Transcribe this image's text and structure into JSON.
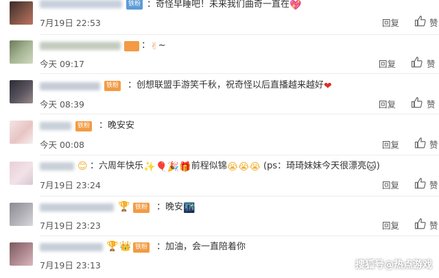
{
  "colors": {
    "badge_blue": "#5b9bd5",
    "badge_orange": "#f29b44",
    "heart": "#e02a2a"
  },
  "comments": [
    {
      "badge": "铁粉",
      "text": "奇怪早睡吧！未来我们曲奇一直在",
      "emoji_end": "sparkle-heart",
      "time": "7月19日 22:53",
      "reply": "回复",
      "likes": "赞"
    },
    {
      "badge": "",
      "text": "",
      "emoji_end": "victory-hand",
      "suffix": "~",
      "time": "今天 09:17",
      "reply": "回复",
      "likes": "赞"
    },
    {
      "badge": "铁粉",
      "text": "创想联盟手游笑千秋，祝奇怪以后直播越来越好",
      "emoji_end": "red-heart",
      "time": "今天 08:39",
      "reply": "回复",
      "likes": "赞"
    },
    {
      "badge": "铁粉",
      "text": "晚安安",
      "time": "今天 00:08",
      "reply": "回复",
      "likes": "赞"
    },
    {
      "badge": "",
      "text": "六周年快乐",
      "mid": "前程似锦",
      "tail": "(ps：琦琦妹妹今天很漂亮",
      "tail_end": ")",
      "time": "7月19日 23:24",
      "reply": "回复",
      "likes": "赞"
    },
    {
      "badge": "铁粉",
      "text": "晚安",
      "time": "7月19日 23:23",
      "reply": "回复",
      "likes": "赞"
    },
    {
      "badge": "铁粉",
      "text": "加油，会一直陪着你",
      "time": "7月19日 23:13",
      "reply": "回复",
      "likes": "赞"
    }
  ],
  "watermark": "搜狐号@热点游戏"
}
